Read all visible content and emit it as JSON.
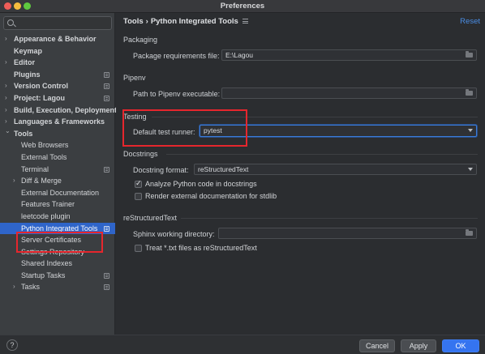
{
  "window": {
    "title": "Preferences"
  },
  "sidebar": {
    "search_placeholder": "",
    "items": [
      {
        "label": "Appearance & Behavior",
        "expander": "closed",
        "bold": true,
        "project": false,
        "indent": 0
      },
      {
        "label": "Keymap",
        "expander": "none",
        "bold": true,
        "project": false,
        "indent": 0
      },
      {
        "label": "Editor",
        "expander": "closed",
        "bold": true,
        "project": false,
        "indent": 0
      },
      {
        "label": "Plugins",
        "expander": "none",
        "bold": true,
        "project": true,
        "indent": 0
      },
      {
        "label": "Version Control",
        "expander": "closed",
        "bold": true,
        "project": true,
        "indent": 0
      },
      {
        "label": "Project: Lagou",
        "expander": "closed",
        "bold": true,
        "project": true,
        "indent": 0
      },
      {
        "label": "Build, Execution, Deployment",
        "expander": "closed",
        "bold": true,
        "project": false,
        "indent": 0
      },
      {
        "label": "Languages & Frameworks",
        "expander": "closed",
        "bold": true,
        "project": false,
        "indent": 0
      },
      {
        "label": "Tools",
        "expander": "open",
        "bold": true,
        "project": false,
        "indent": 0
      },
      {
        "label": "Web Browsers",
        "expander": "none",
        "bold": false,
        "project": false,
        "indent": 1
      },
      {
        "label": "External Tools",
        "expander": "none",
        "bold": false,
        "project": false,
        "indent": 1
      },
      {
        "label": "Terminal",
        "expander": "none",
        "bold": false,
        "project": true,
        "indent": 1
      },
      {
        "label": "Diff & Merge",
        "expander": "closed",
        "bold": false,
        "project": false,
        "indent": 1
      },
      {
        "label": "External Documentation",
        "expander": "none",
        "bold": false,
        "project": false,
        "indent": 1
      },
      {
        "label": "Features Trainer",
        "expander": "none",
        "bold": false,
        "project": false,
        "indent": 1
      },
      {
        "label": "leetcode plugin",
        "expander": "none",
        "bold": false,
        "project": false,
        "indent": 1
      },
      {
        "label": "Python Integrated Tools",
        "expander": "none",
        "bold": false,
        "project": true,
        "indent": 1,
        "selected": true
      },
      {
        "label": "Server Certificates",
        "expander": "none",
        "bold": false,
        "project": false,
        "indent": 1
      },
      {
        "label": "Settings Repository",
        "expander": "none",
        "bold": false,
        "project": false,
        "indent": 1
      },
      {
        "label": "Shared Indexes",
        "expander": "none",
        "bold": false,
        "project": false,
        "indent": 1
      },
      {
        "label": "Startup Tasks",
        "expander": "none",
        "bold": false,
        "project": true,
        "indent": 1
      },
      {
        "label": "Tasks",
        "expander": "closed",
        "bold": false,
        "project": true,
        "indent": 1
      }
    ]
  },
  "main": {
    "breadcrumb": {
      "parent": "Tools",
      "separator": "›",
      "current": "Python Integrated Tools"
    },
    "reset_label": "Reset",
    "packaging": {
      "section": "Packaging",
      "requirements_label": "Package requirements file:",
      "requirements_value": "E:\\Lagou"
    },
    "pipenv": {
      "section": "Pipenv",
      "path_label": "Path to Pipenv executable:",
      "path_value": ""
    },
    "testing": {
      "section": "Testing",
      "runner_label": "Default test runner:",
      "runner_value": "pytest"
    },
    "docstrings": {
      "section": "Docstrings",
      "format_label": "Docstring format:",
      "format_value": "reStructuredText",
      "analyze_label": "Analyze Python code in docstrings",
      "analyze_checked": true,
      "render_label": "Render external documentation for stdlib",
      "render_checked": false
    },
    "rest": {
      "section": "reStructuredText",
      "sphinx_label": "Sphinx working directory:",
      "sphinx_value": "",
      "treat_label": "Treat *.txt files as reStructuredText",
      "treat_checked": false
    }
  },
  "footer": {
    "help_label": "?",
    "cancel_label": "Cancel",
    "apply_label": "Apply",
    "ok_label": "OK"
  },
  "colors": {
    "accent": "#3574f0",
    "selection": "#2f65ca",
    "highlight_box": "#e6262d",
    "link": "#4a8ee6"
  }
}
